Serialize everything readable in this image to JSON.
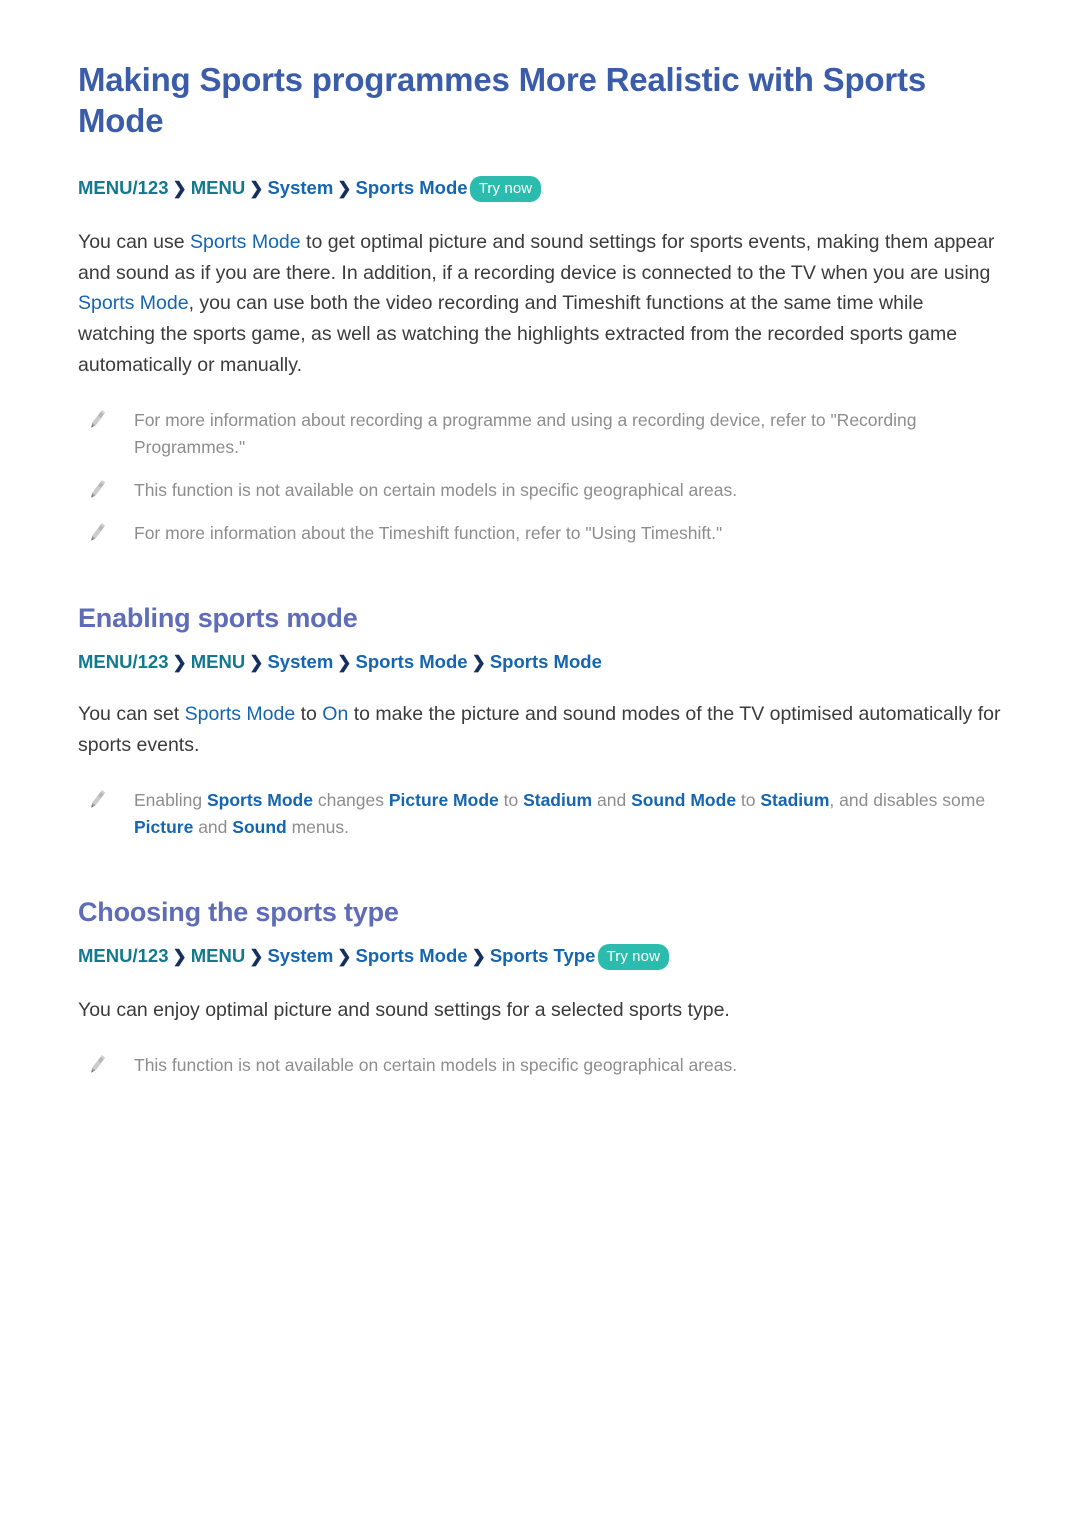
{
  "document": {
    "title": "Making Sports programmes More Realistic with Sports Mode",
    "colors": {
      "title": "#3A5CA9",
      "heading": "#5F6CB8",
      "breadcrumb_menu": "#13798F",
      "breadcrumb_path": "#1565B0",
      "breadcrumb_separator": "#15305E",
      "body_text": "#3B3B3B",
      "note_text": "#8D8D8D",
      "inline_term": "#1565B0",
      "try_now_badge": "#2CBCAE",
      "page_background": "#FFFFFF"
    }
  },
  "intro": {
    "breadcrumb": {
      "menu123": "MENU/123",
      "separator": "❯",
      "menu": "MENU",
      "system": "System",
      "sports_mode": "Sports Mode",
      "try_now": "Try now"
    },
    "paragraph": {
      "p1": "You can use ",
      "term1": "Sports Mode",
      "p2": " to get optimal picture and sound settings for sports events, making them appear and sound as if you are there. In addition, if a recording device is connected to the TV when you are using ",
      "term2": "Sports Mode",
      "p3": ", you can use both the video recording and Timeshift functions at the same time while watching the sports game, as well as watching the highlights extracted from the recorded sports game automatically or manually."
    },
    "notes": {
      "note1": "For more information about recording a programme and using a recording device, refer to \"Recording Programmes.\"",
      "note2": "This function is not available on certain models in specific geographical areas.",
      "note3": "For more information about the Timeshift function, refer to \"Using Timeshift.\""
    }
  },
  "section_enabling": {
    "heading": "Enabling sports mode",
    "breadcrumb": {
      "menu123": "MENU/123",
      "separator": "❯",
      "menu": "MENU",
      "system": "System",
      "sports_mode": "Sports Mode",
      "sports_mode_2": "Sports Mode"
    },
    "paragraph": {
      "p1": "You can set ",
      "term1": "Sports Mode",
      "p2": " to ",
      "term2": "On",
      "p3": " to make the picture and sound modes of the TV optimised automatically for sports events."
    },
    "note": {
      "t1": "Enabling ",
      "term1": "Sports Mode",
      "t2": " changes ",
      "term2": "Picture Mode",
      "t3": " to ",
      "term3": "Stadium",
      "t4": " and ",
      "term4": "Sound Mode",
      "t5": " to ",
      "term5": "Stadium",
      "t6": ", and disables some ",
      "term6": "Picture",
      "t7": " and ",
      "term7": "Sound",
      "t8": " menus."
    }
  },
  "section_choosing": {
    "heading": "Choosing the sports type",
    "breadcrumb": {
      "menu123": "MENU/123",
      "separator": "❯",
      "menu": "MENU",
      "system": "System",
      "sports_mode": "Sports Mode",
      "sports_type": "Sports Type",
      "try_now": "Try now"
    },
    "paragraph": "You can enjoy optimal picture and sound settings for a selected sports type.",
    "note": "This function is not available on certain models in specific geographical areas."
  },
  "icons": {
    "note_icon": "pencil-icon"
  }
}
